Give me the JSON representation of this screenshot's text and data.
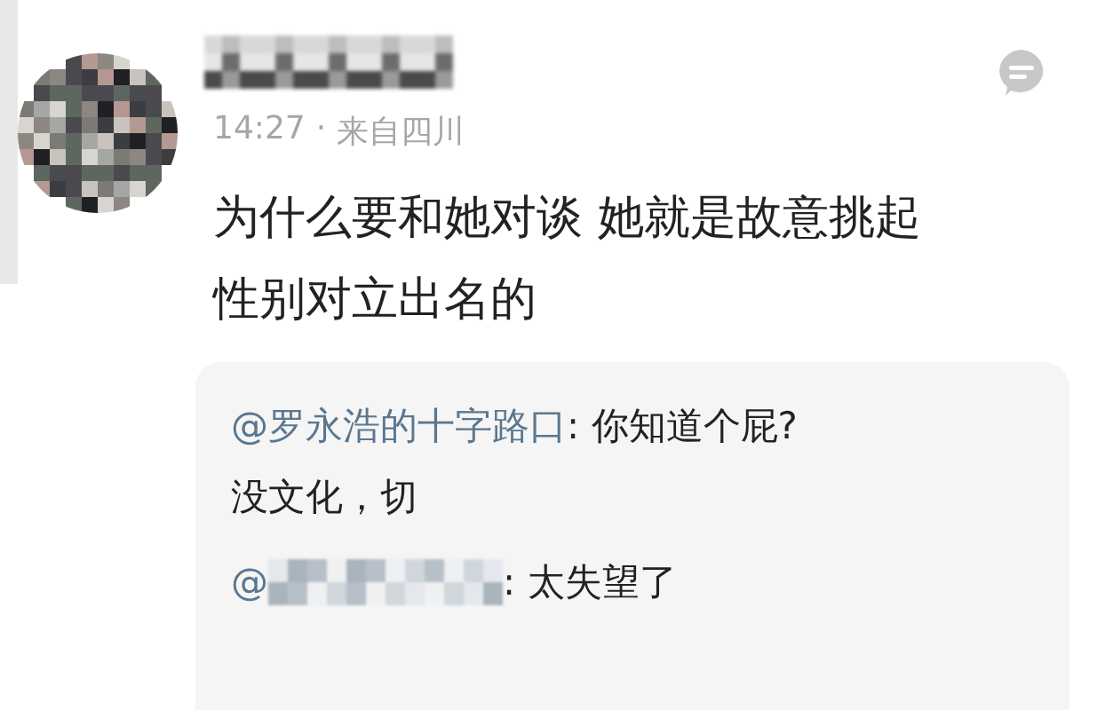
{
  "comment": {
    "time": "14:27",
    "separator": "·",
    "location": "来自四川",
    "text_lines": [
      "为什么要和她对谈  她就是故意挑起",
      "性别对立出名的"
    ]
  },
  "replies": [
    {
      "author": "@罗永浩的十字路口",
      "author_blurred": false,
      "text_lines": [
        ": 你知道个屁?",
        "没文化，切"
      ]
    },
    {
      "author": "@",
      "author_blurred": true,
      "text_lines": [
        ": 太失望了"
      ]
    }
  ]
}
